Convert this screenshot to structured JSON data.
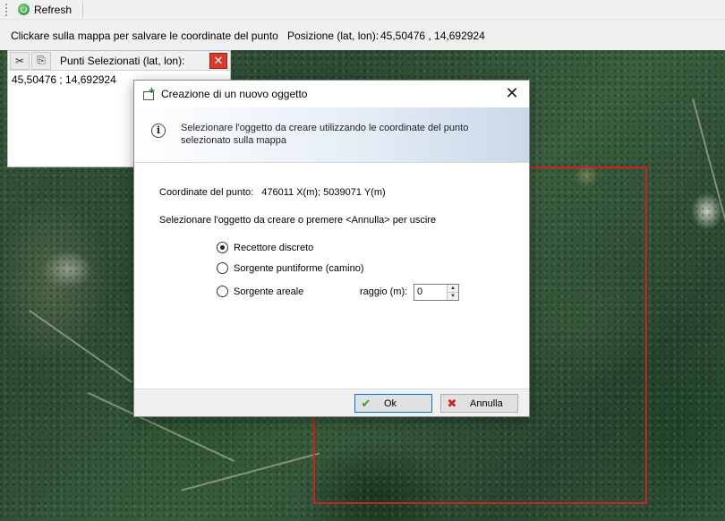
{
  "toolbar": {
    "refresh_label": "Refresh"
  },
  "status": {
    "message": "Clickare sulla mappa per salvare le coordinate del punto",
    "position_label": "Posizione (lat, lon):",
    "position_value": "45,50476 , 14,692924"
  },
  "points_panel": {
    "title": "Punti Selezionati (lat, lon):",
    "points": [
      "45,50476 ; 14,692924"
    ]
  },
  "dialog": {
    "title": "Creazione di un nuovo oggetto",
    "banner": "Selezionare l'oggetto da creare utilizzando le coordinate del punto selezionato sulla mappa",
    "coord_label": "Coordinate del punto:",
    "coord_value": "476011 X(m); 5039071 Y(m)",
    "prompt": "Selezionare l'oggetto da creare o premere <Annulla> per uscire",
    "options": [
      {
        "label": "Recettore discreto",
        "checked": true
      },
      {
        "label": "Sorgente puntiforme (camino)",
        "checked": false
      },
      {
        "label": "Sorgente areale",
        "checked": false
      }
    ],
    "raggio_label": "raggio (m):",
    "raggio_value": "0",
    "ok_label": "Ok",
    "cancel_label": "Annulla"
  },
  "colors": {
    "selection_border": "#d22020",
    "accent": "#0078d7"
  }
}
